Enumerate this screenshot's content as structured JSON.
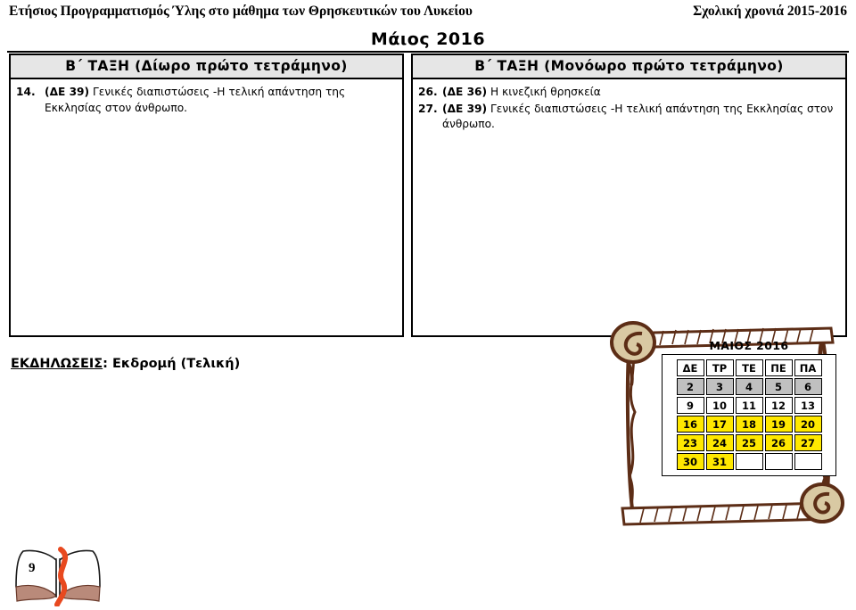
{
  "header": {
    "left": "Ετήσιος Προγραμματισμός Ύλης στο μάθημα των Θρησκευτικών του Λυκείου",
    "right": "Σχολική χρονιά 2015-2016"
  },
  "month_title": "Μάιος 2016",
  "columns": [
    {
      "heading": "Β΄ ΤΑΞΗ (Δίωρο πρώτο τετράμηνο)",
      "entries": [
        {
          "number": "14.",
          "code": "(ΔΕ 39)",
          "text": "Γενικές διαπιστώσεις -Η τελική απάντηση της Εκκλησίας στον άνθρωπο."
        }
      ]
    },
    {
      "heading": "Β΄ ΤΑΞΗ (Μονόωρο πρώτο τετράμηνο)",
      "entries": [
        {
          "number": "26.",
          "code": "(ΔΕ 36)",
          "text": "Η κινεζική θρησκεία"
        },
        {
          "number": "27.",
          "code": "(ΔΕ 39)",
          "text": "Γενικές διαπιστώσεις -Η τελική απάντηση της Εκκλησίας στον άνθρωπο."
        }
      ]
    }
  ],
  "events": {
    "label": "ΕΚΔΗΛΩΣΕΙΣ",
    "separator": ": ",
    "value": "Εκδρομή (Τελική)"
  },
  "calendar": {
    "title": "ΜΑΙΟΣ 2016",
    "day_headers": [
      "ΔΕ",
      "ΤΡ",
      "ΤΕ",
      "ΠΕ",
      "ΠΑ"
    ],
    "weeks": [
      [
        {
          "d": "2",
          "s": "gray"
        },
        {
          "d": "3",
          "s": "gray"
        },
        {
          "d": "4",
          "s": "gray"
        },
        {
          "d": "5",
          "s": "gray"
        },
        {
          "d": "6",
          "s": "gray"
        }
      ],
      [
        {
          "d": "9",
          "s": "plain"
        },
        {
          "d": "10",
          "s": "plain"
        },
        {
          "d": "11",
          "s": "plain"
        },
        {
          "d": "12",
          "s": "plain"
        },
        {
          "d": "13",
          "s": "plain"
        }
      ],
      [
        {
          "d": "16",
          "s": "yellow"
        },
        {
          "d": "17",
          "s": "yellow"
        },
        {
          "d": "18",
          "s": "yellow"
        },
        {
          "d": "19",
          "s": "yellow"
        },
        {
          "d": "20",
          "s": "yellow"
        }
      ],
      [
        {
          "d": "23",
          "s": "yellow"
        },
        {
          "d": "24",
          "s": "yellow"
        },
        {
          "d": "25",
          "s": "yellow"
        },
        {
          "d": "26",
          "s": "yellow"
        },
        {
          "d": "27",
          "s": "yellow"
        }
      ],
      [
        {
          "d": "30",
          "s": "yellow"
        },
        {
          "d": "31",
          "s": "yellow"
        },
        {
          "d": "",
          "s": "empty"
        },
        {
          "d": "",
          "s": "empty"
        },
        {
          "d": "",
          "s": "empty"
        }
      ]
    ]
  },
  "page_number": "9",
  "colors": {
    "heading_bg": "#e6e6e6",
    "calendar_gray": "#c0c0c0",
    "calendar_yellow": "#ffe800",
    "scroll_outline": "#5c2d16",
    "scroll_fill": "#ffffff",
    "scroll_knob": "#d9c9a3",
    "ribbon": "#e8491f"
  }
}
